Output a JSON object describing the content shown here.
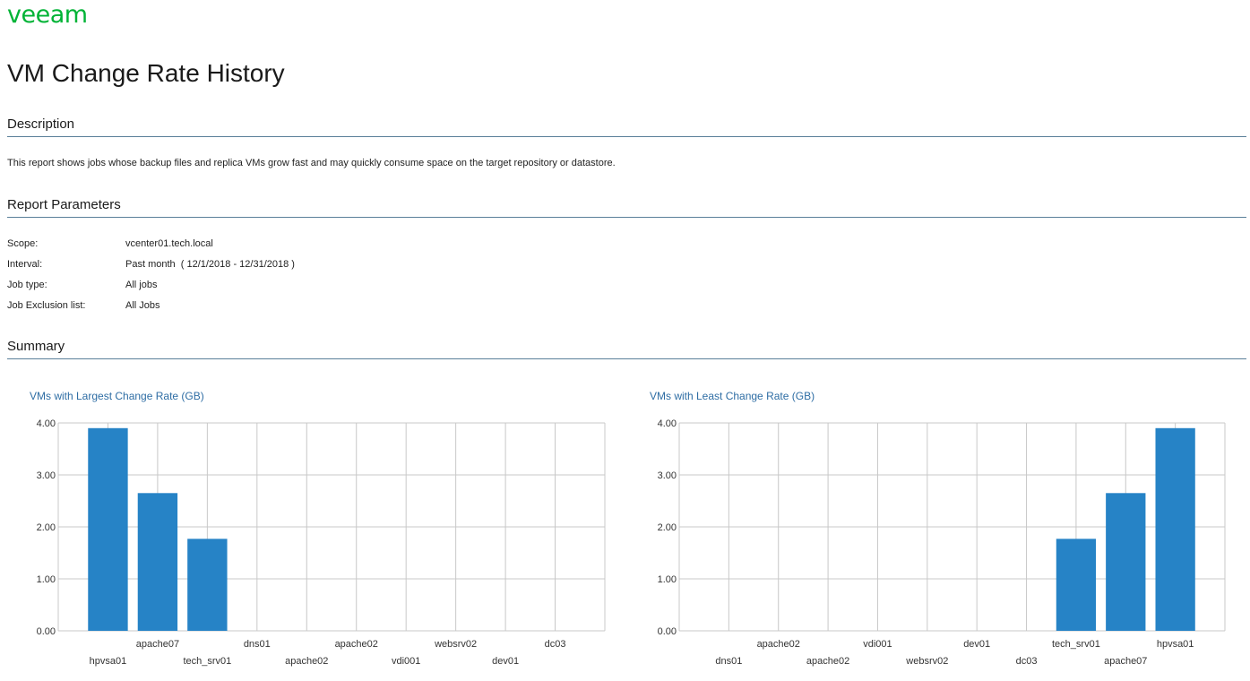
{
  "brand": {
    "logo_text": "veeam",
    "logo_color": "#00b336"
  },
  "page": {
    "title": "VM Change Rate History"
  },
  "sections": {
    "description": {
      "heading": "Description",
      "text": "This report shows jobs whose backup files and replica VMs grow fast and may quickly consume space on the target repository or datastore."
    },
    "parameters": {
      "heading": "Report Parameters",
      "rows": [
        {
          "label": "Scope:",
          "value": "vcenter01.tech.local"
        },
        {
          "label": "Interval:",
          "value": "Past month  ( 12/1/2018 - 12/31/2018 )"
        },
        {
          "label": "Job type:",
          "value": "All jobs"
        },
        {
          "label": "Job Exclusion list:",
          "value": "All Jobs"
        }
      ]
    },
    "summary": {
      "heading": "Summary"
    }
  },
  "colors": {
    "bar": "#2683c6",
    "accent_title": "#2e6da4",
    "rule": "#5a7f99",
    "grid": "#c8c8c8"
  },
  "chart_data": [
    {
      "type": "bar",
      "title": "VMs with Largest Change Rate (GB)",
      "categories": [
        "hpvsa01",
        "apache07",
        "tech_srv01",
        "dns01",
        "apache02",
        "apache02",
        "vdi001",
        "websrv02",
        "dev01",
        "dc03"
      ],
      "values": [
        3.9,
        2.65,
        1.77,
        0,
        0,
        0,
        0,
        0,
        0,
        0
      ],
      "ylim": [
        0,
        4
      ],
      "yticks": [
        "0.00",
        "1.00",
        "2.00",
        "3.00",
        "4.00"
      ],
      "grid": true,
      "xlabel": "",
      "ylabel": ""
    },
    {
      "type": "bar",
      "title": "VMs with Least Change Rate (GB)",
      "categories": [
        "dns01",
        "apache02",
        "apache02",
        "vdi001",
        "websrv02",
        "dev01",
        "dc03",
        "tech_srv01",
        "apache07",
        "hpvsa01"
      ],
      "values": [
        0,
        0,
        0,
        0,
        0,
        0,
        0,
        1.77,
        2.65,
        3.9
      ],
      "ylim": [
        0,
        4
      ],
      "yticks": [
        "0.00",
        "1.00",
        "2.00",
        "3.00",
        "4.00"
      ],
      "grid": true,
      "xlabel": "",
      "ylabel": ""
    }
  ]
}
